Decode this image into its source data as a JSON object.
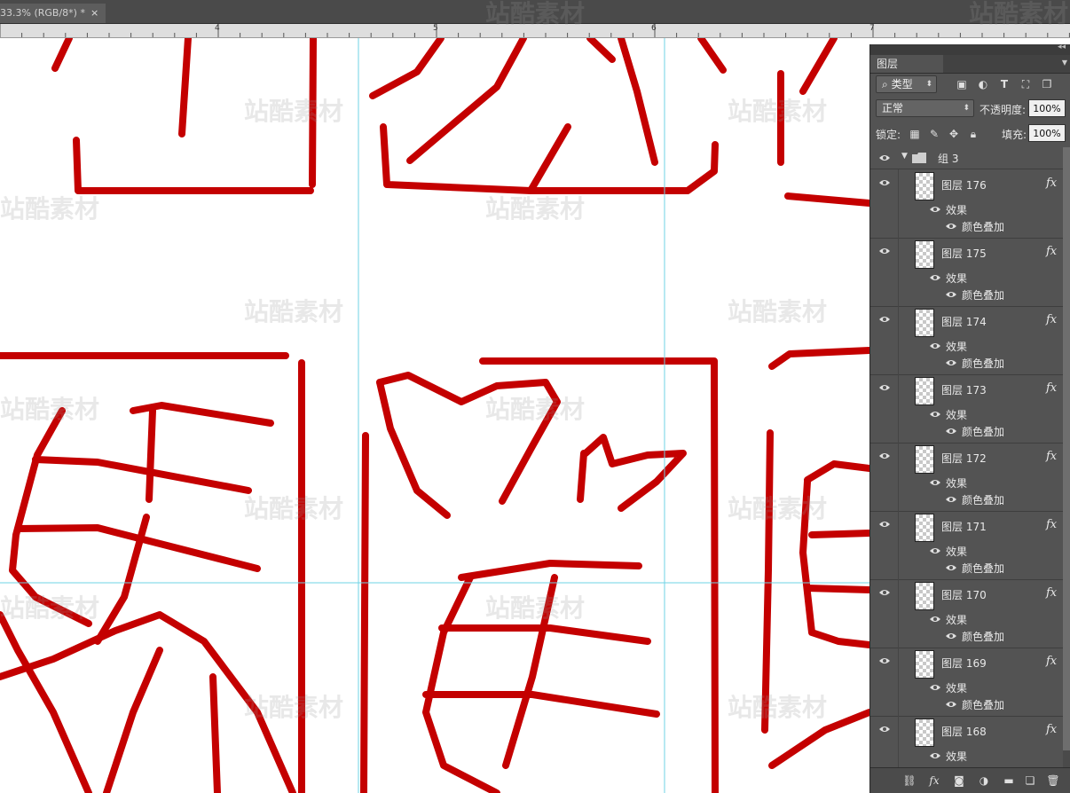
{
  "document_tab": {
    "title": "33.3% (RGB/8*) *",
    "close_glyph": "×"
  },
  "ruler": {
    "numbers": [
      "4",
      "5",
      "6",
      "7"
    ]
  },
  "watermark": {
    "text": "站酷素材"
  },
  "panel": {
    "tab_label": "图层",
    "filter": {
      "label": "类型",
      "icon": "search-icon"
    },
    "blend_mode": "正常",
    "opacity_label": "不透明度:",
    "opacity_value": "100%",
    "lock_label": "锁定:",
    "fill_label": "填充:",
    "fill_value": "100%",
    "group": {
      "name": "组 3"
    },
    "layers": [
      {
        "name": "图层 176",
        "fx": "fx",
        "effects_label": "效果",
        "effect": "颜色叠加"
      },
      {
        "name": "图层 175",
        "fx": "fx",
        "effects_label": "效果",
        "effect": "颜色叠加"
      },
      {
        "name": "图层 174",
        "fx": "fx",
        "effects_label": "效果",
        "effect": "颜色叠加"
      },
      {
        "name": "图层 173",
        "fx": "fx",
        "effects_label": "效果",
        "effect": "颜色叠加"
      },
      {
        "name": "图层 172",
        "fx": "fx",
        "effects_label": "效果",
        "effect": "颜色叠加"
      },
      {
        "name": "图层 171",
        "fx": "fx",
        "effects_label": "效果",
        "effect": "颜色叠加"
      },
      {
        "name": "图层 170",
        "fx": "fx",
        "effects_label": "效果",
        "effect": "颜色叠加"
      },
      {
        "name": "图层 169",
        "fx": "fx",
        "effects_label": "效果",
        "effect": "颜色叠加"
      },
      {
        "name": "图层 168",
        "fx": "fx",
        "effects_label": "效果",
        "effect": ""
      }
    ]
  },
  "colors": {
    "seal_red": "#c40000",
    "guide": "#6fd3e6",
    "panel_bg": "#535353"
  }
}
